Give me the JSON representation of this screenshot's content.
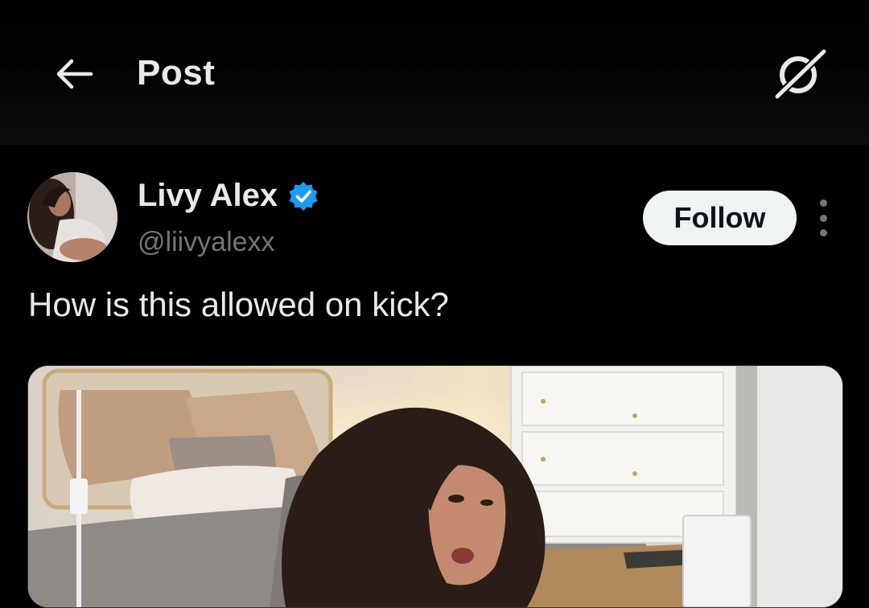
{
  "header": {
    "title": "Post",
    "back_icon": "arrow-left-icon",
    "grok_icon": "grok-icon"
  },
  "author": {
    "name": "Livy Alex",
    "handle": "@liivyalexx",
    "verified": true,
    "verified_color": "#1d9bf0"
  },
  "actions": {
    "follow_label": "Follow",
    "more_icon": "more-vertical-icon"
  },
  "post": {
    "text": "How is this allowed on kick?"
  },
  "media": {
    "type": "image"
  },
  "colors": {
    "background": "#000000",
    "primary_text": "#e7e9ea",
    "secondary_text": "#71767b",
    "follow_bg": "#eff3f4",
    "follow_text": "#0f1419"
  }
}
